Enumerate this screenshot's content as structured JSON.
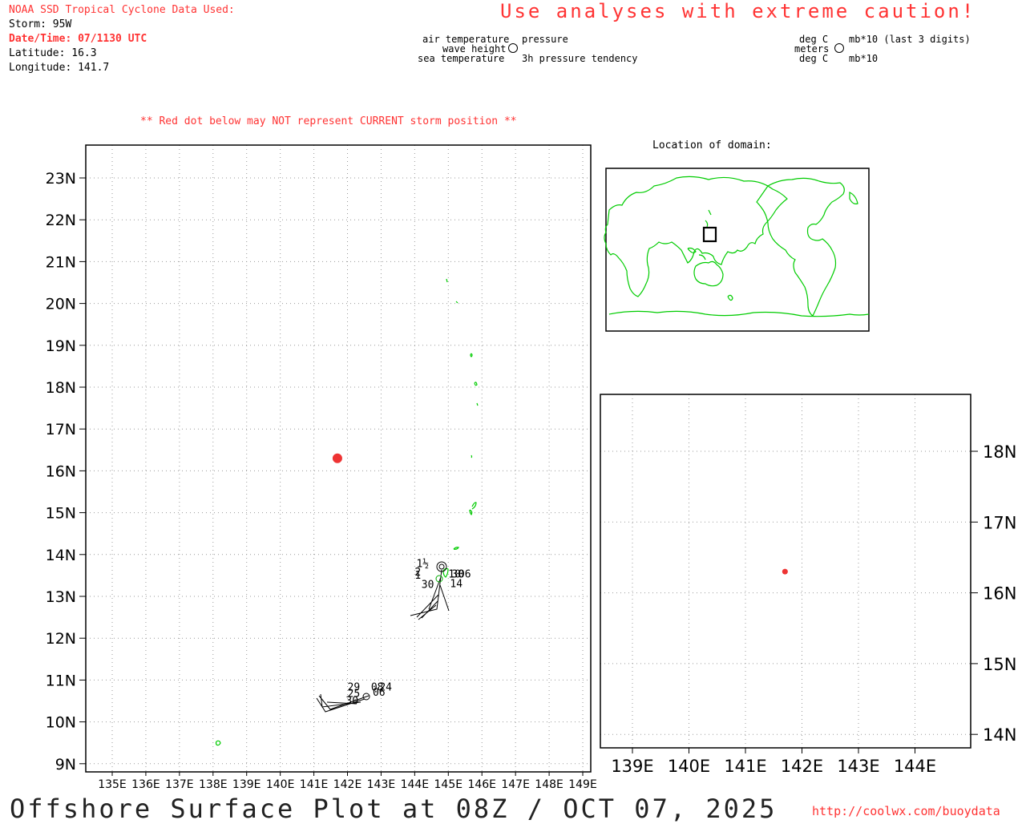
{
  "header": {
    "source_title": "NOAA SSD Tropical Cyclone Data Used:",
    "storm": "Storm: 95W",
    "datetime": "Date/Time: 07/1130 UTC",
    "latitude": "Latitude: 16.3",
    "longitude": "Longitude: 141.7",
    "caution": "Use analyses with extreme caution!",
    "red_dot_note": "** Red dot below may NOT represent CURRENT storm position **"
  },
  "legend": {
    "air_temperature": "air temperature",
    "wave_height": "wave height",
    "sea_temperature": "sea temperature",
    "pressure": "pressure",
    "pressure_tendency": "3h pressure tendency",
    "deg_c_1": "deg C",
    "meters": "meters",
    "deg_c_2": "deg C",
    "mb_last3": "mb*10 (last 3 digits)",
    "mb10": "mb*10"
  },
  "main_map": {
    "lat_labels": [
      "23N",
      "22N",
      "21N",
      "20N",
      "19N",
      "18N",
      "17N",
      "16N",
      "15N",
      "14N",
      "13N",
      "12N",
      "11N",
      "10N",
      "9N"
    ],
    "lon_labels": [
      "135E",
      "136E",
      "137E",
      "138E",
      "139E",
      "140E",
      "141E",
      "142E",
      "143E",
      "144E",
      "145E",
      "146E",
      "147E",
      "148E",
      "149E"
    ],
    "storm_position": {
      "lat": 16.3,
      "lon": 141.7
    },
    "station_labels": [
      {
        "text": "1½",
        "lat": 13.7,
        "lon": 144.05
      },
      {
        "text": "2",
        "lat": 13.5,
        "lon": 144.0
      },
      {
        "text": "10",
        "lat": 13.45,
        "lon": 145.0
      },
      {
        "text": "30",
        "lat": 13.45,
        "lon": 145.1
      },
      {
        "text": "06",
        "lat": 13.45,
        "lon": 145.3
      },
      {
        "text": "1",
        "lat": 13.42,
        "lon": 144.0
      },
      {
        "text": "30",
        "lat": 13.2,
        "lon": 144.2
      },
      {
        "text": "14",
        "lat": 13.22,
        "lon": 145.05
      },
      {
        "text": "29",
        "lat": 10.75,
        "lon": 142.0
      },
      {
        "text": "08",
        "lat": 10.75,
        "lon": 142.7
      },
      {
        "text": "24",
        "lat": 10.75,
        "lon": 142.95
      },
      {
        "text": "25",
        "lat": 10.6,
        "lon": 142.0
      },
      {
        "text": "30",
        "lat": 10.42,
        "lon": 141.95
      },
      {
        "text": "06",
        "lat": 10.62,
        "lon": 142.75
      }
    ]
  },
  "inset_globe": {
    "label": "Location of domain:"
  },
  "zoom_map": {
    "lat_labels": [
      "18N",
      "17N",
      "16N",
      "15N",
      "14N"
    ],
    "lon_labels": [
      "139E",
      "140E",
      "141E",
      "142E",
      "143E",
      "144E"
    ],
    "storm_position": {
      "lat": 16.3,
      "lon": 141.7
    }
  },
  "footer": {
    "title": "Offshore Surface Plot at 08Z / OCT 07, 2025",
    "url": "http://coolwx.com/buoydata"
  },
  "colors": {
    "accent_red": "#ff3333",
    "coast_green": "#00cc00",
    "grid": "#999999"
  }
}
